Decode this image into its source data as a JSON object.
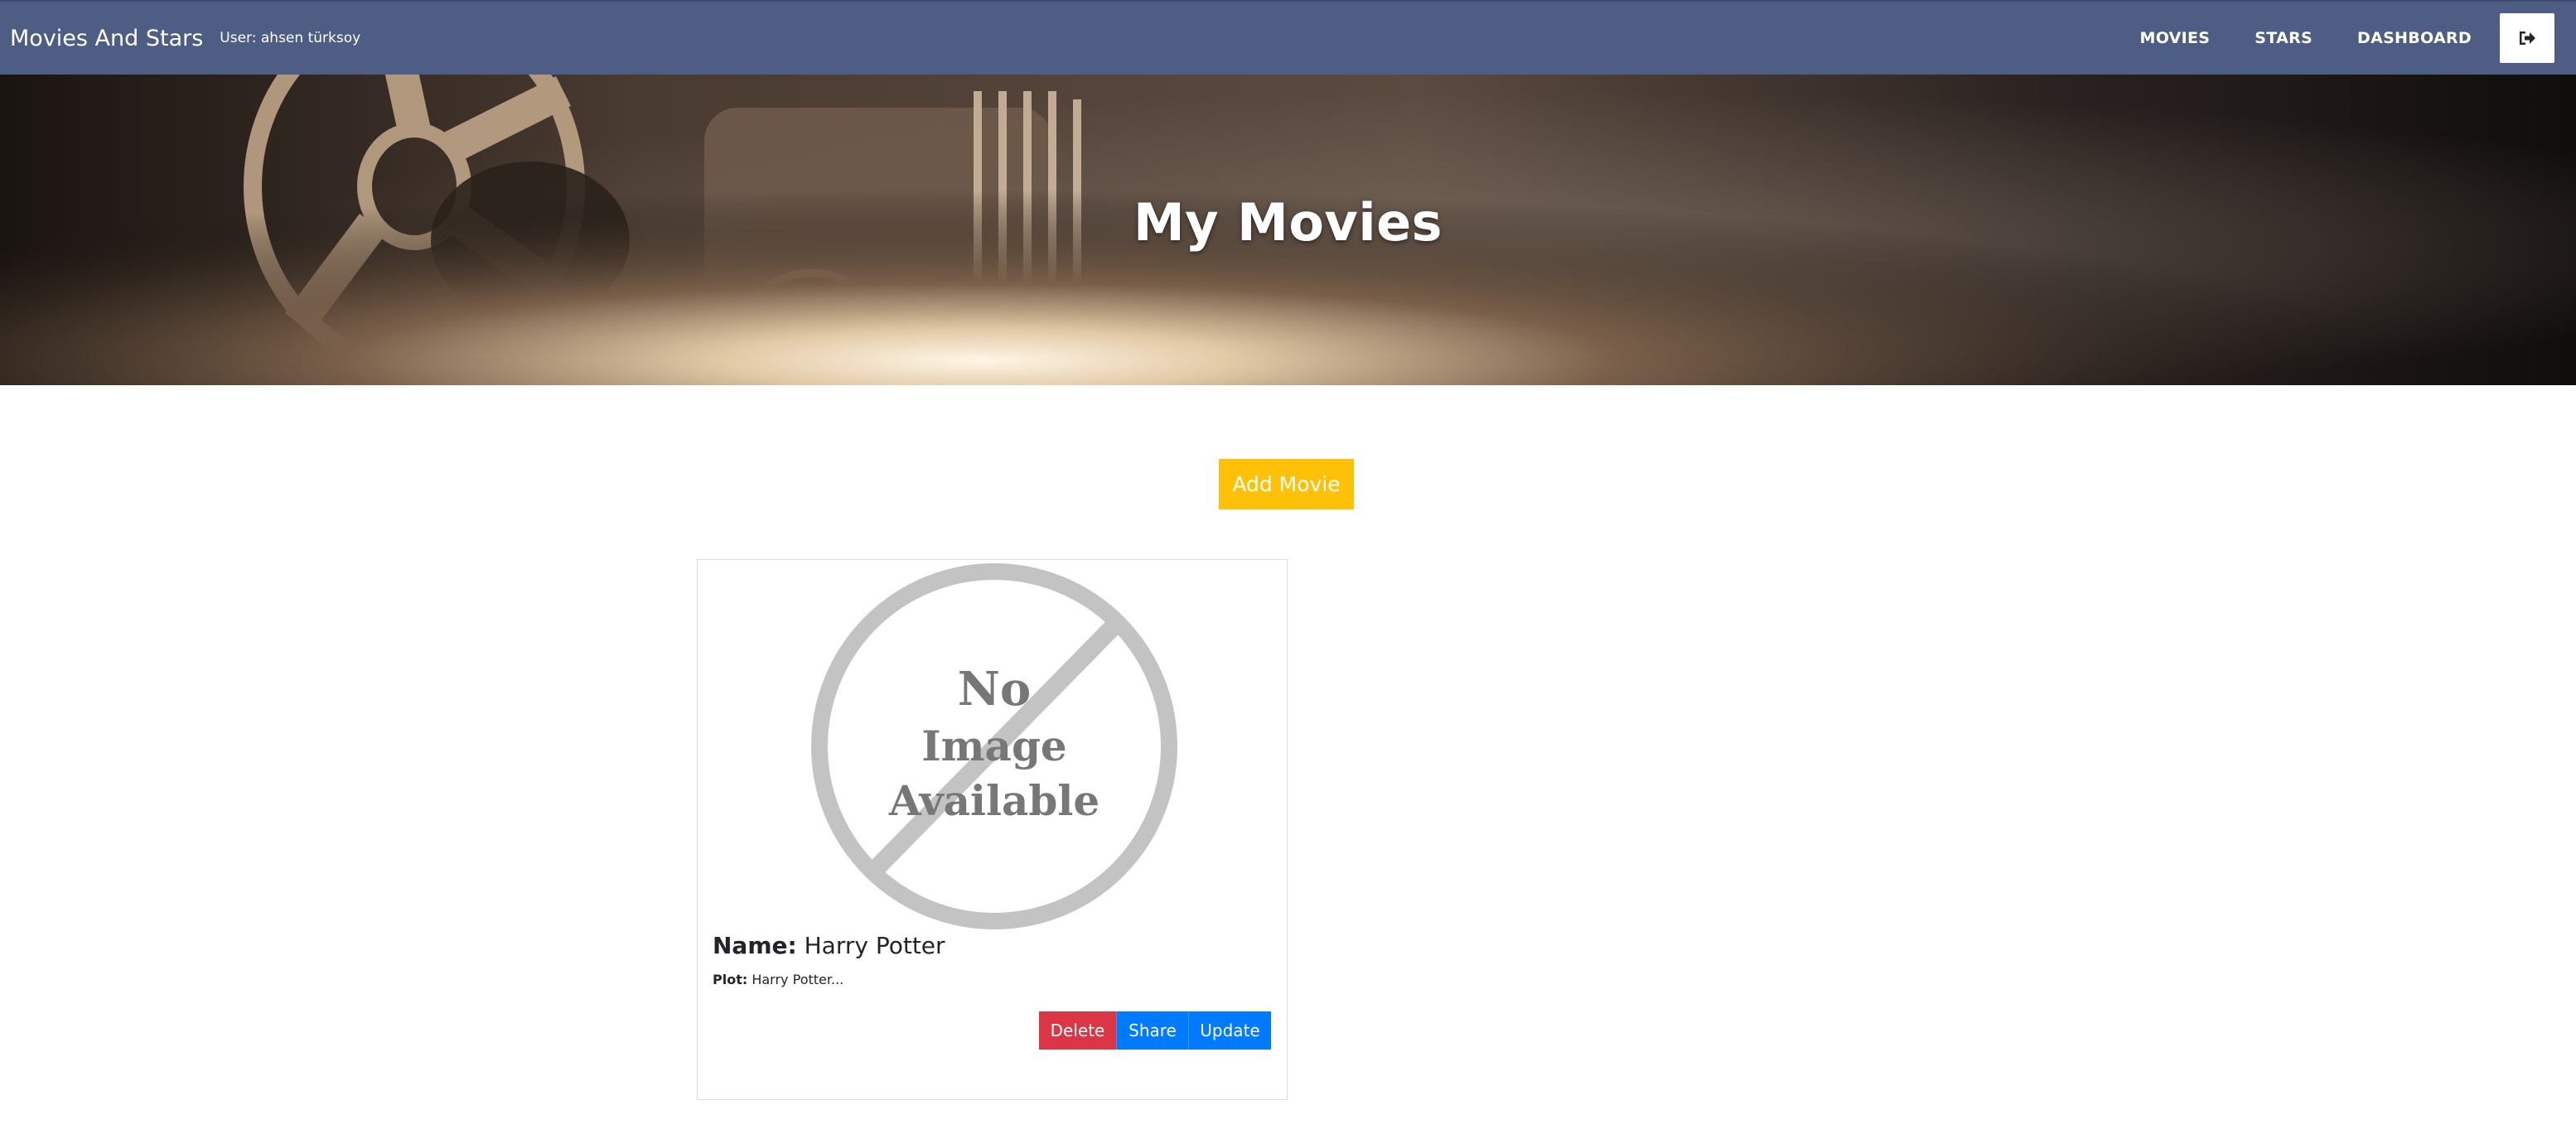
{
  "navbar": {
    "brand": "Movies And Stars",
    "user": "User: ahsen türksoy",
    "links": [
      "MOVIES",
      "STARS",
      "DASHBOARD"
    ],
    "logout_icon": "sign-out-icon",
    "bg_color": "#4e5d83"
  },
  "hero": {
    "title": "My Movies"
  },
  "add_button": {
    "label": "Add Movie",
    "color": "#ffc107"
  },
  "movie_card": {
    "image_text": [
      "No",
      "Image",
      "Available"
    ],
    "name_label": "Name:",
    "name_value": "Harry Potter",
    "plot_label": "Plot:",
    "plot_value": "Harry Potter...",
    "buttons": {
      "delete": "Delete",
      "share": "Share",
      "update": "Update"
    },
    "colors": {
      "delete": "#dc3545",
      "primary": "#007bff"
    }
  }
}
